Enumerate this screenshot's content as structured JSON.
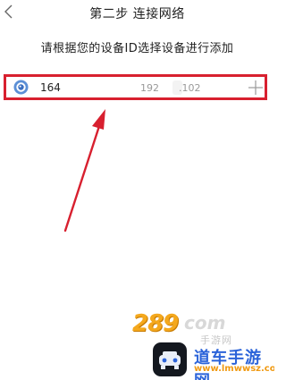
{
  "header": {
    "back_icon": "chevron-left-icon",
    "title": "第二步 连接网络"
  },
  "instruction": "请根据您的设备ID选择设备进行添加",
  "devices": [
    {
      "icon": "camera-icon",
      "name": "164",
      "ip_part_1": "192",
      "ip_part_2": ".102",
      "add_icon": "plus-icon",
      "highlight_color": "#d8202f"
    }
  ],
  "annotation": {
    "type": "red-arrow",
    "color": "#d8202f",
    "points_to": "device-row"
  },
  "watermark": {
    "logo_number": "289",
    "logo_suffix": "com",
    "logo_cn": "手游网",
    "brand": "道车手游网",
    "url": "www.lmwwsz.com"
  }
}
